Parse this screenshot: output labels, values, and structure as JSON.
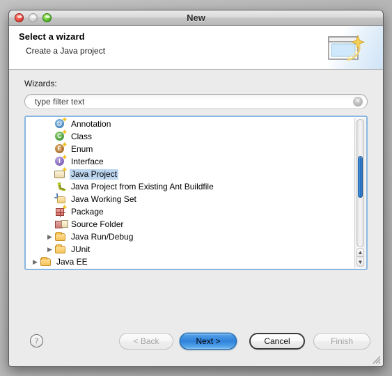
{
  "window": {
    "title": "New",
    "traffic_lights": [
      {
        "name": "close",
        "color": "#e4483c"
      },
      {
        "name": "minimize",
        "color": "#d2d2d2"
      },
      {
        "name": "zoom",
        "color": "#5cc02c"
      }
    ]
  },
  "banner": {
    "title": "Select a wizard",
    "subtitle": "Create a Java project",
    "icon": "wizard-sparkle-window-icon"
  },
  "filter": {
    "label": "Wizards:",
    "value": "",
    "placeholder": "type filter text",
    "clear_icon": "clear-circle-icon"
  },
  "tree": {
    "selected": "Java Project",
    "selection_color": "#bcd6f0",
    "focus_border_color": "#89b6e2",
    "items": [
      {
        "label": "Annotation",
        "icon": "annotation-at-icon",
        "indent": 1,
        "expander": "none",
        "selected": false
      },
      {
        "label": "Class",
        "icon": "class-c-icon",
        "indent": 1,
        "expander": "none",
        "selected": false
      },
      {
        "label": "Enum",
        "icon": "enum-e-icon",
        "indent": 1,
        "expander": "none",
        "selected": false
      },
      {
        "label": "Interface",
        "icon": "interface-i-icon",
        "indent": 1,
        "expander": "none",
        "selected": false
      },
      {
        "label": "Java Project",
        "icon": "java-project-icon",
        "indent": 1,
        "expander": "none",
        "selected": true
      },
      {
        "label": "Java Project from Existing Ant Buildfile",
        "icon": "ant-buildfile-icon",
        "indent": 1,
        "expander": "none",
        "selected": false
      },
      {
        "label": "Java Working Set",
        "icon": "java-working-set-icon",
        "indent": 1,
        "expander": "none",
        "selected": false
      },
      {
        "label": "Package",
        "icon": "package-icon",
        "indent": 1,
        "expander": "none",
        "selected": false
      },
      {
        "label": "Source Folder",
        "icon": "source-folder-icon",
        "indent": 1,
        "expander": "none",
        "selected": false
      },
      {
        "label": "Java Run/Debug",
        "icon": "folder-icon",
        "indent": 1,
        "expander": "collapsed",
        "selected": false
      },
      {
        "label": "JUnit",
        "icon": "folder-icon",
        "indent": 1,
        "expander": "collapsed",
        "selected": false
      },
      {
        "label": "Java EE",
        "icon": "folder-icon",
        "indent": 0,
        "expander": "collapsed",
        "selected": false
      }
    ],
    "scrollbar": {
      "thumb_color": "#2e7ed0",
      "up_arrow": "▲",
      "down_arrow": "▼"
    }
  },
  "footer": {
    "help_label": "?",
    "buttons": [
      {
        "id": "back",
        "label": "< Back",
        "state": "disabled"
      },
      {
        "id": "next",
        "label": "Next >",
        "state": "default"
      },
      {
        "id": "cancel",
        "label": "Cancel",
        "state": "enabled"
      },
      {
        "id": "finish",
        "label": "Finish",
        "state": "disabled"
      }
    ],
    "resize_grip": "resize-grip-icon"
  }
}
